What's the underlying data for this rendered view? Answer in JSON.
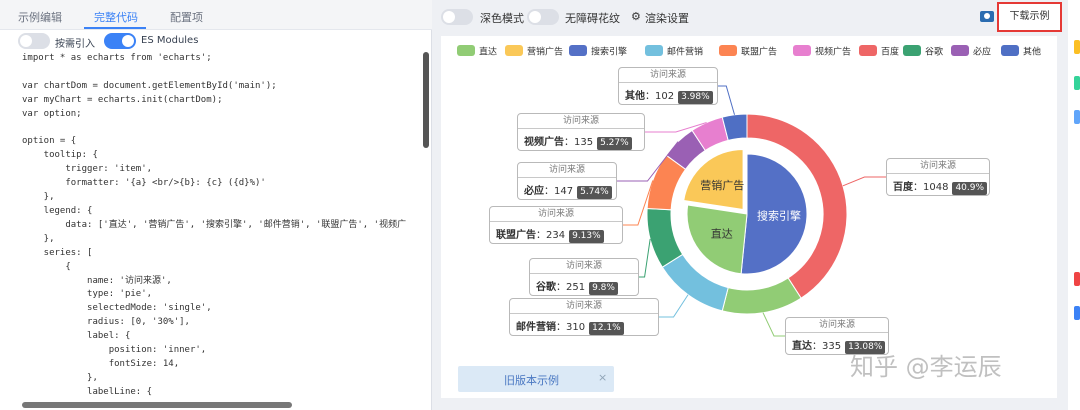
{
  "left_panel": {
    "tabs": [
      "示例编辑",
      "完整代码",
      "配置项"
    ],
    "toggles": [
      {
        "label": "按需引入",
        "on": false
      },
      {
        "label": "ES Modules",
        "on": true
      }
    ],
    "code_lines": [
      "import * as echarts from 'echarts';",
      "",
      "var chartDom = document.getElementById('main');",
      "var myChart = echarts.init(chartDom);",
      "var option;",
      "",
      "option = {",
      "    tooltip: {",
      "        trigger: 'item',",
      "        formatter: '{a} <br/>{b}: {c} ({d}%)'",
      "    },",
      "    legend: {",
      "        data: ['直达', '营销广告', '搜索引擎', '邮件营销', '联盟广告', '视频广",
      "    },",
      "    series: [",
      "        {",
      "            name: '访问来源',",
      "            type: 'pie',",
      "            selectedMode: 'single',",
      "            radius: [0, '30%'],",
      "            label: {",
      "                position: 'inner',",
      "                fontSize: 14,",
      "            },",
      "            labelLine: {"
    ]
  },
  "topbar": {
    "dark_mode": "深色模式",
    "accessibility": "无障碍花纹",
    "render_settings": "渲染设置",
    "download": "下载示例"
  },
  "old_example": {
    "label": "旧版本示例",
    "close": "×"
  },
  "watermark": "知乎 @李运辰",
  "chart_data": {
    "type": "pie",
    "series_name": "访问来源",
    "legend": [
      {
        "name": "直达",
        "color": "#91cc75"
      },
      {
        "name": "营销广告",
        "color": "#fac858"
      },
      {
        "name": "搜索引擎",
        "color": "#5470c6"
      },
      {
        "name": "邮件营销",
        "color": "#73c0de"
      },
      {
        "name": "联盟广告",
        "color": "#fc8452"
      },
      {
        "name": "视频广告",
        "color": "#e77fcf"
      },
      {
        "name": "百度",
        "color": "#ee6666"
      },
      {
        "name": "谷歌",
        "color": "#3ba272"
      },
      {
        "name": "必应",
        "color": "#9a60b4"
      },
      {
        "name": "其他",
        "color": "#4f6fc4"
      }
    ],
    "inner": [
      {
        "name": "搜索引擎",
        "value": 1548,
        "color": "#5470c6"
      },
      {
        "name": "直达",
        "value": 775,
        "color": "#91cc75"
      },
      {
        "name": "营销广告",
        "value": 679,
        "color": "#fac858",
        "selected": true
      }
    ],
    "outer": [
      {
        "name": "百度",
        "value": 1048,
        "percent": "40.9%",
        "color": "#ee6666"
      },
      {
        "name": "直达",
        "value": 335,
        "percent": "13.08%",
        "color": "#91cc75"
      },
      {
        "name": "邮件营销",
        "value": 310,
        "percent": "12.1%",
        "color": "#73c0de"
      },
      {
        "name": "谷歌",
        "value": 251,
        "percent": "9.8%",
        "color": "#3ba272"
      },
      {
        "name": "联盟广告",
        "value": 234,
        "percent": "9.13%",
        "color": "#fc8452"
      },
      {
        "name": "必应",
        "value": 147,
        "percent": "5.74%",
        "color": "#9a60b4"
      },
      {
        "name": "视频广告",
        "value": 135,
        "percent": "5.27%",
        "color": "#e77fcf"
      },
      {
        "name": "其他",
        "value": 102,
        "percent": "3.98%",
        "color": "#4f6fc4"
      }
    ]
  }
}
